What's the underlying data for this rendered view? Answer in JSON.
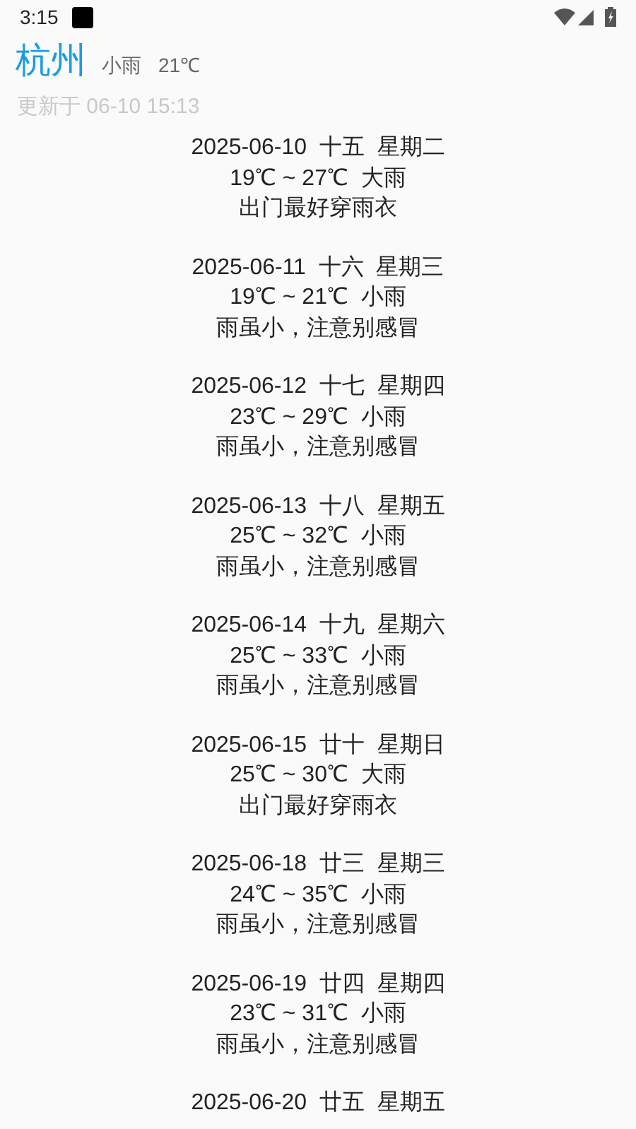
{
  "status_bar": {
    "time": "3:15"
  },
  "header": {
    "city": "杭州",
    "weather": "小雨",
    "temperature": "21℃",
    "updated": "更新于 06-10 15:13"
  },
  "forecast": [
    {
      "date_line": "2025-06-10  十五  星期二",
      "temp_line": "19℃ ~ 27℃  大雨",
      "tip": "出门最好穿雨衣"
    },
    {
      "date_line": "2025-06-11  十六  星期三",
      "temp_line": "19℃ ~ 21℃  小雨",
      "tip": "雨虽小，注意别感冒"
    },
    {
      "date_line": "2025-06-12  十七  星期四",
      "temp_line": "23℃ ~ 29℃  小雨",
      "tip": "雨虽小，注意别感冒"
    },
    {
      "date_line": "2025-06-13  十八  星期五",
      "temp_line": "25℃ ~ 32℃  小雨",
      "tip": "雨虽小，注意别感冒"
    },
    {
      "date_line": "2025-06-14  十九  星期六",
      "temp_line": "25℃ ~ 33℃  小雨",
      "tip": "雨虽小，注意别感冒"
    },
    {
      "date_line": "2025-06-15  廿十  星期日",
      "temp_line": "25℃ ~ 30℃  大雨",
      "tip": "出门最好穿雨衣"
    },
    {
      "date_line": "2025-06-18  廿三  星期三",
      "temp_line": "24℃ ~ 35℃  小雨",
      "tip": "雨虽小，注意别感冒"
    },
    {
      "date_line": "2025-06-19  廿四  星期四",
      "temp_line": "23℃ ~ 31℃  小雨",
      "tip": "雨虽小，注意别感冒"
    },
    {
      "date_line": "2025-06-20  廿五  星期五"
    }
  ]
}
